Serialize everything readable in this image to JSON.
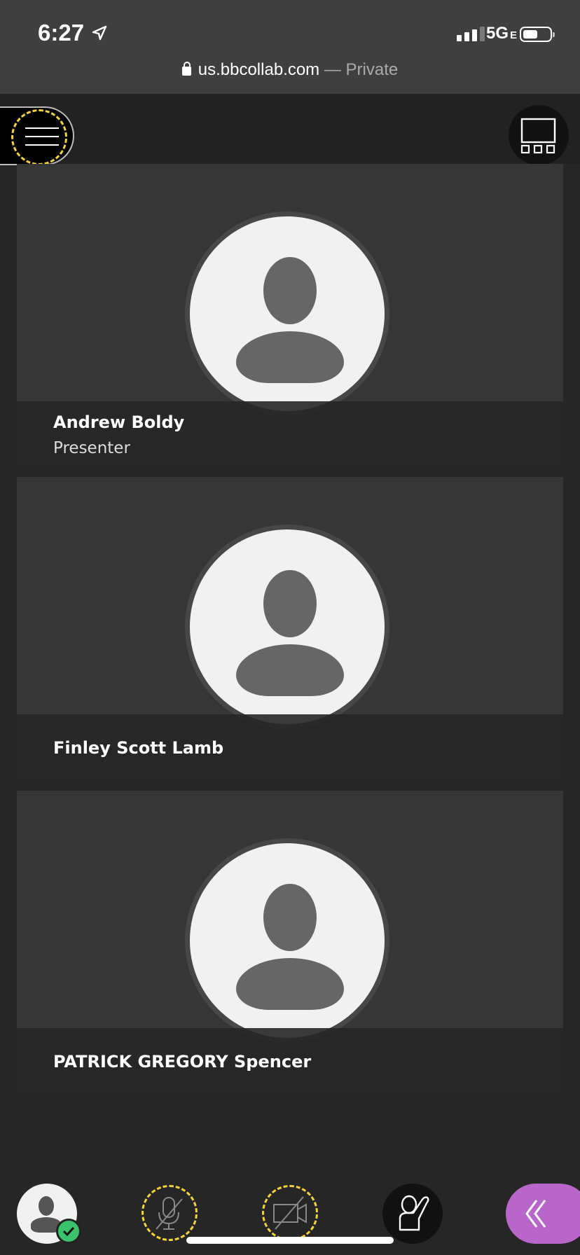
{
  "status_bar": {
    "time": "6:27",
    "network": "5G",
    "network_suffix": "E"
  },
  "browser": {
    "domain": "us.bbcollab.com",
    "separator": " — ",
    "mode": "Private"
  },
  "participants": [
    {
      "name": "Andrew Boldy",
      "role": "Presenter"
    },
    {
      "name": "Finley Scott Lamb",
      "role": ""
    },
    {
      "name": "PATRICK GREGORY Spencer",
      "role": ""
    }
  ],
  "colors": {
    "accent_dash": "#f2d33a",
    "collapse_button": "#b866c9",
    "status_ok": "#3ac36a"
  },
  "icons": {
    "menu": "hamburger-icon",
    "layout": "gallery-layout-icon",
    "mic": "mic-off-icon",
    "camera": "camera-off-icon",
    "hand": "raise-hand-icon",
    "collapse": "double-chevron-left-icon"
  }
}
